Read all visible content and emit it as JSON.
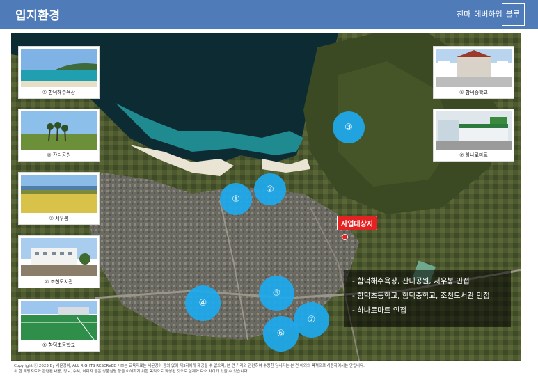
{
  "header": {
    "title": "입지환경",
    "brand": [
      "천마",
      "에버하임",
      "블루"
    ]
  },
  "thumbnails": [
    {
      "caption": "① 함덕해수욕장",
      "icon": "beach-photo"
    },
    {
      "caption": "② 잔디공원",
      "icon": "park-photo"
    },
    {
      "caption": "③ 서우봉",
      "icon": "field-photo"
    },
    {
      "caption": "④ 조천도서관",
      "icon": "library-photo"
    },
    {
      "caption": "⑤ 함덕초등학교",
      "icon": "school-field-photo"
    },
    {
      "caption": "⑥ 함덕중학교",
      "icon": "middle-school-photo"
    },
    {
      "caption": "⑦ 하나로마트",
      "icon": "mart-photo"
    }
  ],
  "markers": [
    "①",
    "②",
    "③",
    "④",
    "⑤",
    "⑥",
    "⑦"
  ],
  "site_label": "사업대상지",
  "info": [
    "- 함덕해수욕장, 잔디공원, 서우봉 인접",
    "- 함덕초등학교, 함덕중학교, 조천도서관 인접",
    "- 하나로마트 인접"
  ],
  "footer": {
    "line1": "Copyright ⓒ 2023 By 서문경이, ALL RIGHTS RESERVED / 本본 교육자료는 서문경이 동의 없이 제3자에게 제공될 수 없으며, 본 건 거래와 관련하여 수령한 당사자는 본 건 이외의 목적으로 사용하여서는 안됩니다.",
    "line2": "위 한 해당지료와 관련된 내용, 정보, 수치, 이미지 등은 상품설명 등을 이해하기 위한 목적으로 작성된 것으로 실제와 다소 차이가 있을 수 있습니다."
  },
  "colors": {
    "header": "#4f7bb8",
    "marker": "#1daaee",
    "site": "#e52222"
  }
}
